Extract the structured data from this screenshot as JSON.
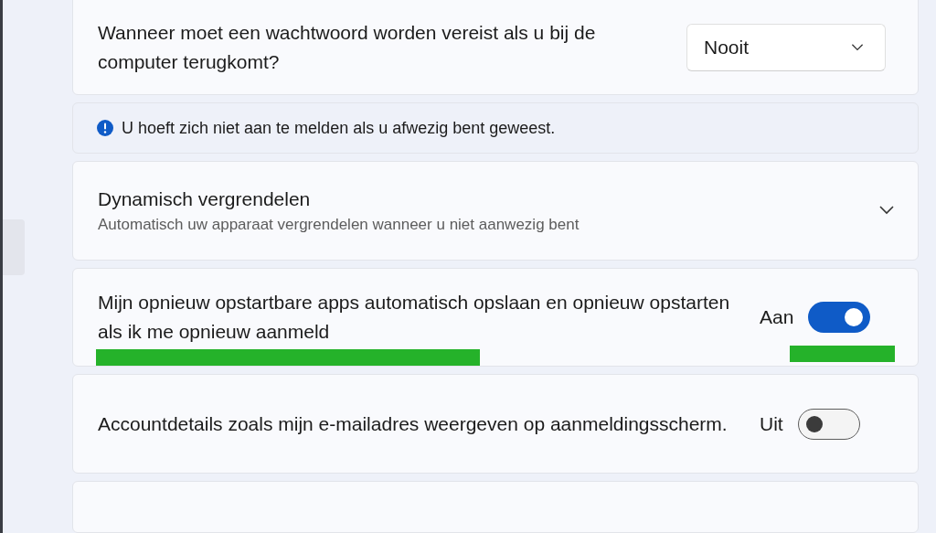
{
  "settings": [
    {
      "kind": "dropdown",
      "title": "Wanneer moet een wachtwoord worden vereist als u bij de computer terugkomt?",
      "value": "Nooit"
    },
    {
      "kind": "info",
      "text": "U hoeft zich niet aan te melden als u afwezig bent geweest."
    },
    {
      "kind": "expander",
      "title": "Dynamisch vergrendelen",
      "subtitle": "Automatisch uw apparaat vergrendelen wanneer u niet aanwezig bent",
      "expanded": false
    },
    {
      "kind": "toggle",
      "title": "Mijn opnieuw opstartbare apps automatisch opslaan en opnieuw opstarten als ik me opnieuw aanmeld",
      "state_label": "Aan",
      "on": true,
      "highlighted": true
    },
    {
      "kind": "toggle",
      "title": "Accountdetails zoals mijn e-mailadres weergeven op aanmeldingsscherm.",
      "state_label": "Uit",
      "on": false,
      "highlighted": false
    },
    {
      "kind": "empty"
    }
  ]
}
